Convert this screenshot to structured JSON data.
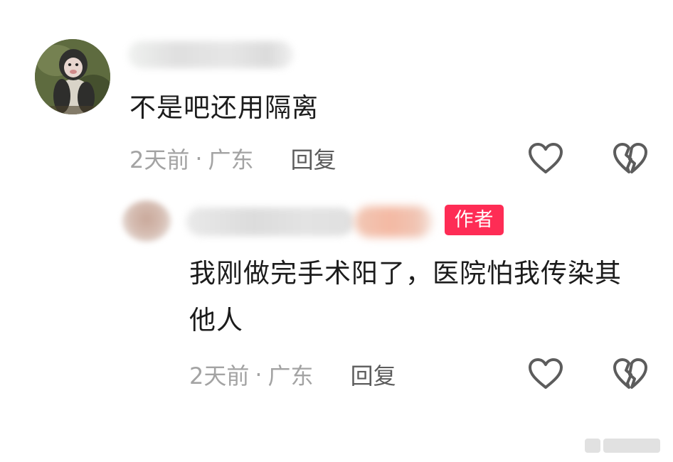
{
  "comments": [
    {
      "text": "不是吧还用隔离",
      "time": "2天前",
      "separator": "·",
      "location": "广东",
      "reply_label": "回复"
    },
    {
      "badge": "作者",
      "text": "我刚做完手术阳了，医院怕我传染其他人",
      "time": "2天前",
      "separator": "·",
      "location": "广东",
      "reply_label": "回复"
    }
  ],
  "icons": {
    "like": "heart-outline-icon",
    "dislike": "broken-heart-icon"
  },
  "colors": {
    "author_badge": "#fe2c55",
    "meta_text": "#a3a3a3",
    "reply_text": "#5c5c5c",
    "icon_stroke": "#5c5c5c"
  }
}
